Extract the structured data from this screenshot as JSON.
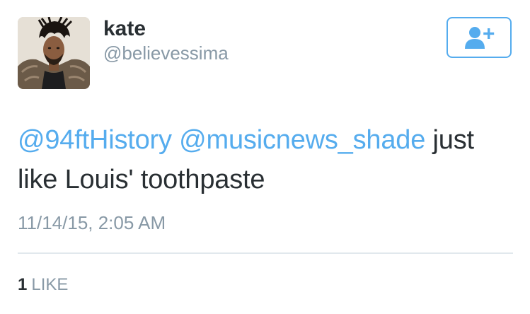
{
  "user": {
    "name": "kate",
    "handle": "@believessima"
  },
  "follow_button": {
    "icon": "add-user-icon",
    "color": "#55acee"
  },
  "tweet": {
    "mention_1": "@94ftHistory",
    "mention_2": "@musicnews_shade",
    "text_after_mentions": "just",
    "text_line_2": "like Louis' toothpaste",
    "timestamp": "11/14/15, 2:05 AM"
  },
  "stats": {
    "likes_count": "1",
    "likes_label": "LIKE"
  },
  "colors": {
    "link": "#55acee",
    "text": "#292f33",
    "muted": "#8899a6",
    "divider": "#e1e8ed"
  }
}
